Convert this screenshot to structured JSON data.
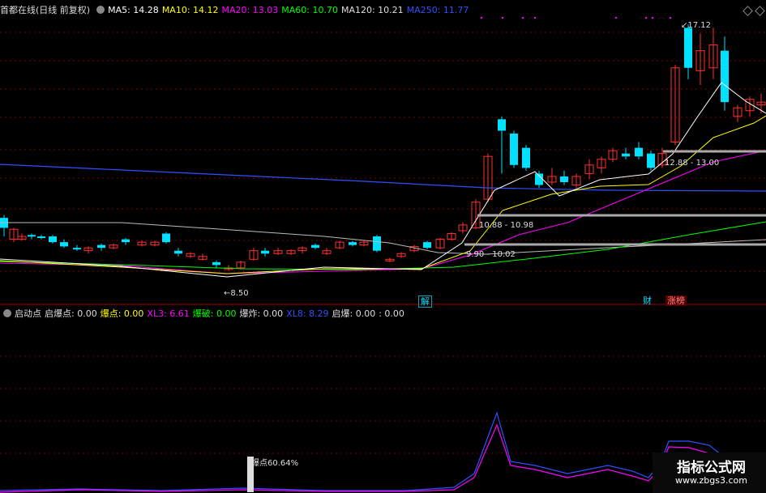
{
  "header": {
    "stock": "首都在线(日线 前复权)",
    "ma": [
      {
        "label": "MA5: 14.28",
        "color": "#ffffff"
      },
      {
        "label": "MA10: 14.12",
        "color": "#ffff00"
      },
      {
        "label": "MA20: 13.03",
        "color": "#ff00ff"
      },
      {
        "label": "MA60: 10.70",
        "color": "#00ff00"
      },
      {
        "label": "MA120: 10.21",
        "color": "#dddddd"
      },
      {
        "label": "MA250: 11.77",
        "color": "#3050ff"
      }
    ]
  },
  "indicator": {
    "items": [
      {
        "label": "启动点",
        "color": "#dddddd"
      },
      {
        "label": "启爆点: 0.00",
        "color": "#dddddd"
      },
      {
        "label": "爆点: 0.00",
        "color": "#ffff00"
      },
      {
        "label": "XL3: 6.61",
        "color": "#ff00ff"
      },
      {
        "label": "爆破: 0.00",
        "color": "#00ff00"
      },
      {
        "label": "爆炸: 0.00",
        "color": "#dddddd"
      },
      {
        "label": "XL8: 8.29",
        "color": "#3050ff"
      },
      {
        "label": "启爆: 0.00",
        "color": "#dddddd"
      },
      {
        "label": ": 0.00",
        "color": "#dddddd"
      }
    ]
  },
  "annotations": {
    "high": "17.12",
    "low": "8.50",
    "zone1": "12.88 - 13.00",
    "zone2": "10.88 - 10.98",
    "zone3": "9.90 - 10.02",
    "pct": "爆点60.64%"
  },
  "tags": {
    "jie": "解",
    "cai": "财",
    "zhangting": "涨榜"
  },
  "watermark": {
    "title": "指标公式网",
    "url": "www.zbgs3.com"
  },
  "colors": {
    "up": "#ff3030",
    "down": "#00e0ff",
    "grid": "#7a0000"
  }
}
